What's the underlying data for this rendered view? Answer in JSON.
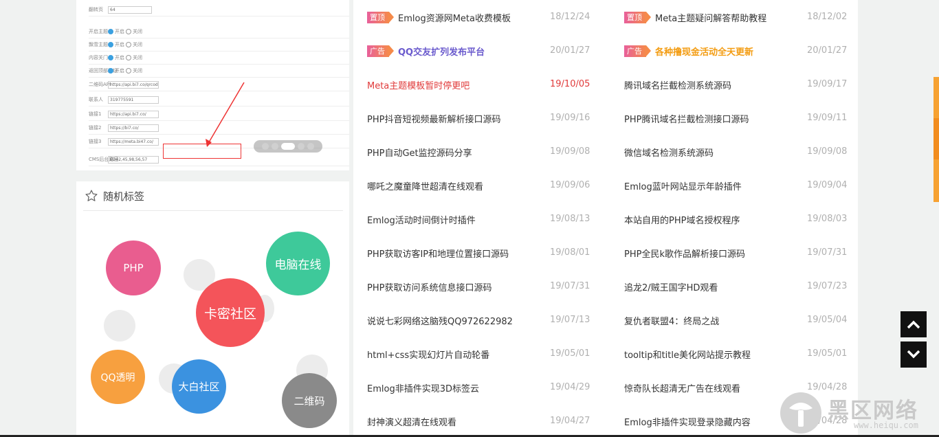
{
  "slider": {
    "mock_form_rows": [
      {
        "label": "翻转页",
        "value": "64"
      },
      {
        "label": "开启主题",
        "opt_on": "开启",
        "opt_off": "关闭"
      },
      {
        "label": "飘雪主题",
        "opt_on": "开启",
        "opt_off": "关闭"
      },
      {
        "label": "内容关门",
        "opt_on": "开启",
        "opt_off": "关闭"
      },
      {
        "label": "返回顶部按钮",
        "opt_on": "开启",
        "opt_off": "关闭"
      },
      {
        "label": "二维码API",
        "value": "https://api.bi7.co/qrcode.php?t"
      },
      {
        "label": "联系人",
        "value": "319775591"
      },
      {
        "label": "链接1",
        "value": "https://api.bi7.co/"
      },
      {
        "label": "链接2",
        "value": "https://bi7.co/"
      },
      {
        "label": "链接3",
        "value": "https://meta.bi47.co/"
      },
      {
        "label": "CMS后台路径",
        "value": "ED42,45,98,56,57"
      }
    ],
    "dots": 5,
    "active_dot": 3
  },
  "tags": {
    "title": "随机标签",
    "items": [
      {
        "label": "PHP",
        "color": "#e95d8f"
      },
      {
        "label": "电脑在线",
        "color": "#3ec99a"
      },
      {
        "label": "卡密社区",
        "color": "#f4545a"
      },
      {
        "label": "QQ透明",
        "color": "#f7a03f"
      },
      {
        "label": "大白社区",
        "color": "#3b92e0"
      },
      {
        "label": "二维码",
        "color": "#8a8a8a"
      }
    ]
  },
  "badges": {
    "top": "置顶",
    "ad": "广告"
  },
  "list": {
    "left": [
      {
        "title": "Emlog资源网Meta收费模板",
        "date": "18/12/24",
        "badge": "top"
      },
      {
        "title": "QQ交友扩列发布平台",
        "date": "20/01/27",
        "badge": "ad",
        "color": "#6a5acd"
      },
      {
        "title": "Meta主题模板暂时停更吧",
        "date": "19/10/05",
        "color": "#e03a3a",
        "date_color": "#e03a3a"
      },
      {
        "title": "PHP抖音短视频最新解析接口源码",
        "date": "19/09/16"
      },
      {
        "title": "PHP自动Get监控源码分享",
        "date": "19/09/08"
      },
      {
        "title": "哪吒之魔童降世超清在线观看",
        "date": "19/09/06"
      },
      {
        "title": "Emlog活动时间倒计时插件",
        "date": "19/08/13"
      },
      {
        "title": "PHP获取访客IP和地理位置接口源码",
        "date": "19/08/01"
      },
      {
        "title": "PHP获取访问系统信息接口源码",
        "date": "19/07/31"
      },
      {
        "title": "说说七彩网络这脑残QQ972622982",
        "date": "19/07/13"
      },
      {
        "title": "html+css实现幻灯片自动轮番",
        "date": "19/05/01"
      },
      {
        "title": "Emlog非插件实现3D标签云",
        "date": "19/04/29"
      },
      {
        "title": "封神演义超清在线观看",
        "date": "19/04/27"
      }
    ],
    "right": [
      {
        "title": "Meta主题疑问解答帮助教程",
        "date": "18/12/02",
        "badge": "top"
      },
      {
        "title": "各种撸现金活动全天更新",
        "date": "20/01/27",
        "badge": "ad",
        "color": "#f39c12"
      },
      {
        "title": "腾讯域名拦截检测系统源码",
        "date": "19/09/17"
      },
      {
        "title": "PHP腾讯域名拦截检测接口源码",
        "date": "19/09/11"
      },
      {
        "title": "微信域名检测系统源码",
        "date": "19/09/08"
      },
      {
        "title": "Emlog蓝叶网站显示年龄插件",
        "date": "19/09/04"
      },
      {
        "title": "本站自用的PHP域名授权程序",
        "date": "19/08/03"
      },
      {
        "title": "PHP全民k歌作品解析接口源码",
        "date": "19/07/31"
      },
      {
        "title": "追龙2/贼王国字HD观看",
        "date": "19/07/23"
      },
      {
        "title": "复仇者联盟4：终局之战",
        "date": "19/05/04"
      },
      {
        "title": "tooltip和title美化网站提示教程",
        "date": "19/05/01"
      },
      {
        "title": "惊奇队长超清无广告在线观看",
        "date": "19/04/28"
      },
      {
        "title": "Emlog非插件实现登录隐藏内容",
        "date": "19/04/28"
      }
    ]
  },
  "watermark": {
    "text": "黑区网络",
    "url": "www.heiqu.com"
  },
  "icons": {
    "scroll_up": "chevron-up-icon",
    "scroll_down": "chevron-down-icon",
    "tags": "star-icon"
  }
}
